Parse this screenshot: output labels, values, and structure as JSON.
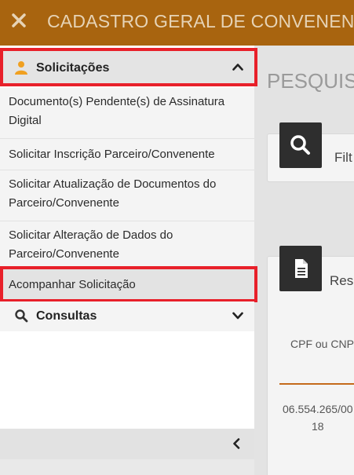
{
  "header": {
    "title": "CADASTRO GERAL DE CONVENENTES",
    "close_icon": "close-icon"
  },
  "sidebar": {
    "sections": [
      {
        "label": "Solicitações",
        "icon": "user-icon",
        "expanded": true,
        "items": [
          {
            "label": "Documento(s) Pendente(s) de Assinatura Digital"
          },
          {
            "label": "Solicitar Inscrição Parceiro/Convenente"
          },
          {
            "label": "Solicitar Atualização de Documentos do Parceiro/Convenente"
          },
          {
            "label": "Solicitar Alteração de Dados do Parceiro/Convenente"
          },
          {
            "label": "Acompanhar Solicitação"
          }
        ]
      },
      {
        "label": "Consultas",
        "icon": "search-icon",
        "expanded": false
      }
    ],
    "footer_icon": "chevron-left-icon"
  },
  "background_page": {
    "page_title": "PESQUISA",
    "filter_label": "Filt",
    "results_label": "Resu",
    "column_header": "CPF ou CNP",
    "row_value_line1": "06.554.265/00",
    "row_value_line2": "18"
  },
  "colors": {
    "header_bg": "#a8640f",
    "highlight": "#e8202a",
    "accent_orange": "#c46a1a"
  }
}
